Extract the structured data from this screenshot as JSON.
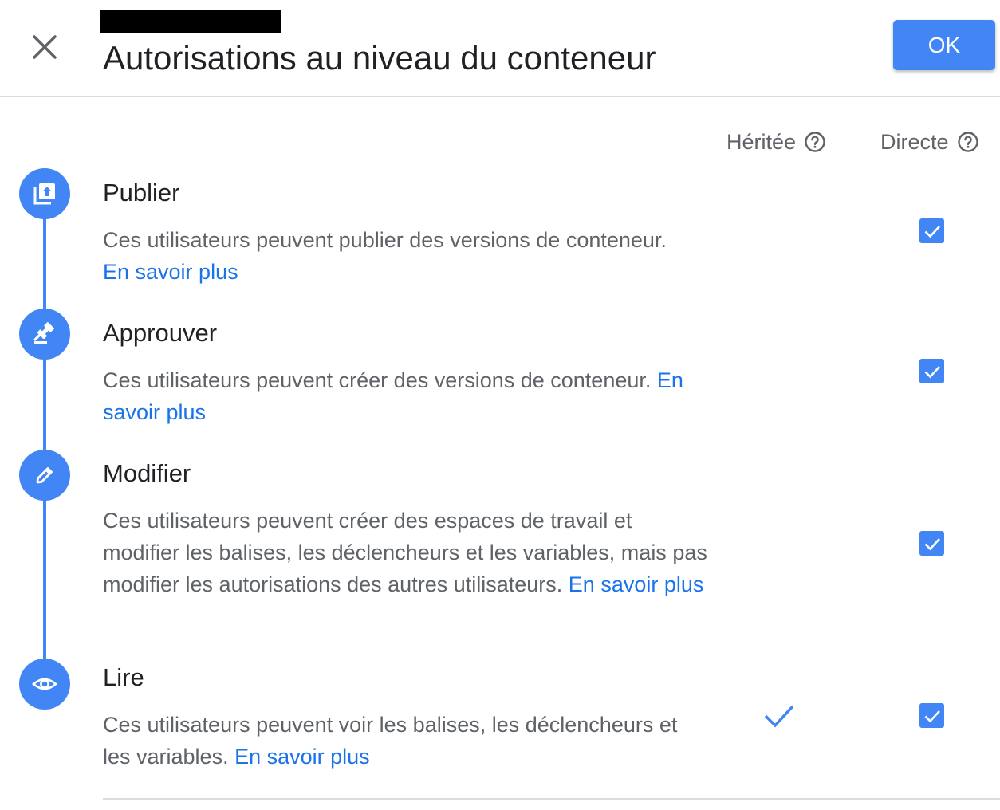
{
  "dialog": {
    "title": "Autorisations au niveau du conteneur",
    "ok_label": "OK"
  },
  "columns": {
    "inherited": "Héritée",
    "direct": "Directe"
  },
  "permissions": [
    {
      "title": "Publier",
      "icon": "publish-icon",
      "description": "Ces utilisateurs peuvent publier des versions de conteneur.",
      "link": "En savoir plus",
      "inherited": false,
      "direct": true
    },
    {
      "title": "Approuver",
      "icon": "gavel-icon",
      "description": "Ces utilisateurs peuvent créer des versions de conteneur.",
      "link": "En savoir plus",
      "inherited": false,
      "direct": true
    },
    {
      "title": "Modifier",
      "icon": "pencil-icon",
      "description": "Ces utilisateurs peuvent créer des espaces de travail et modifier les balises, les déclencheurs et les variables, mais pas modifier les autorisations des autres utilisateurs.",
      "link": "En savoir plus",
      "inherited": false,
      "direct": true
    },
    {
      "title": "Lire",
      "icon": "eye-icon",
      "description": "Ces utilisateurs peuvent voir les balises, les déclencheurs et les variables.",
      "link": "En savoir plus",
      "inherited": true,
      "direct": true
    }
  ],
  "colors": {
    "accent": "#4285f4",
    "link": "#1a73e8",
    "text_primary": "#202124",
    "text_secondary": "#5f6368"
  }
}
